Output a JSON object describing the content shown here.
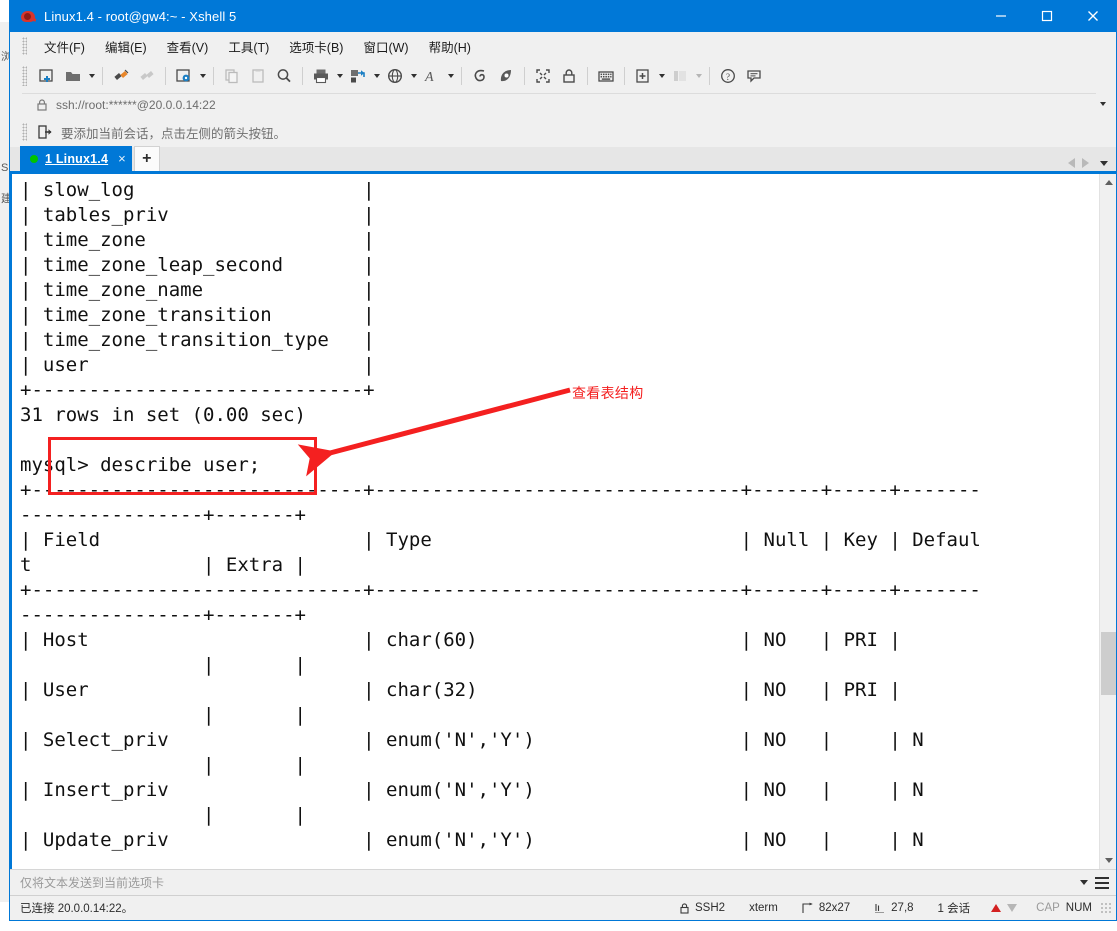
{
  "window": {
    "title": "Linux1.4 - root@gw4:~ - Xshell 5",
    "app_icon": "xshell-icon",
    "controls": {
      "minimize": "minimize-icon",
      "maximize": "maximize-icon",
      "close": "close-icon"
    }
  },
  "menubar": {
    "items": [
      {
        "label": "文件(F)",
        "name": "menu-file"
      },
      {
        "label": "编辑(E)",
        "name": "menu-edit"
      },
      {
        "label": "查看(V)",
        "name": "menu-view"
      },
      {
        "label": "工具(T)",
        "name": "menu-tools"
      },
      {
        "label": "选项卡(B)",
        "name": "menu-tabs"
      },
      {
        "label": "窗口(W)",
        "name": "menu-window"
      },
      {
        "label": "帮助(H)",
        "name": "menu-help"
      }
    ]
  },
  "toolbar": {
    "icons": [
      "new-session-icon",
      "open-folder-icon",
      "connect-icon",
      "disconnect-icon",
      "session-properties-icon",
      "copy-icon",
      "paste-icon",
      "find-icon",
      "print-icon",
      "transfer-icon",
      "globe-icon",
      "font-icon",
      "ssh-tunnel-icon",
      "sftp-icon",
      "fullscreen-icon",
      "lock-icon",
      "keyboard-icon",
      "add-note-icon",
      "layout-icon",
      "help-icon",
      "comment-icon"
    ]
  },
  "addressbar": {
    "lock_icon": "lock-icon",
    "value": "ssh://root:******@20.0.0.14:22",
    "dropdown_icon": "chevron-down-icon"
  },
  "notice": {
    "icon": "add-session-icon",
    "text": "要添加当前会话，点击左侧的箭头按钮。"
  },
  "tabs": {
    "items": [
      {
        "index": "1",
        "label": "1 Linux1.4",
        "close": "×",
        "status_dot": "connected"
      }
    ],
    "new_tab_label": "+",
    "nav_prev": "prev-tab-icon",
    "nav_next": "next-tab-icon",
    "nav_list": "tab-list-icon"
  },
  "terminal": {
    "content": "| slow_log                    |\n| tables_priv                 |\n| time_zone                   |\n| time_zone_leap_second       |\n| time_zone_name              |\n| time_zone_transition        |\n| time_zone_transition_type   |\n| user                        |\n+-----------------------------+\n31 rows in set (0.00 sec)\n\nmysql> describe user;\n+-----------------------------+--------------------------------+------+-----+-------\n----------------+-------+\n| Field                       | Type                           | Null | Key | Defaul\nt               | Extra |\n+-----------------------------+--------------------------------+------+-----+-------\n----------------+-------+\n| Host                        | char(60)                       | NO   | PRI |\n                |       |\n| User                        | char(32)                       | NO   | PRI |\n                |       |\n| Select_priv                 | enum('N','Y')                  | NO   |     | N\n                |       |\n| Insert_priv                 | enum('N','Y')                  | NO   |     | N\n                |       |\n| Update_priv                 | enum('N','Y')                  | NO   |     | N",
    "lines": [
      "| slow_log                    |",
      "| tables_priv                 |",
      "| time_zone                   |",
      "| time_zone_leap_second       |",
      "| time_zone_name              |",
      "| time_zone_transition        |",
      "| time_zone_transition_type   |",
      "| user                        |",
      "+-----------------------------+",
      "31 rows in set (0.00 sec)",
      "",
      "mysql> describe user;",
      "+-----------------------------+--------------------------------+------+-----+-------",
      "----------------+-------+",
      "| Field                       | Type                           | Null | Key | Defaul",
      "t               | Extra |",
      "+-----------------------------+--------------------------------+------+-----+-------",
      "----------------+-------+",
      "| Host                        | char(60)                       | NO   | PRI |",
      "                |       |",
      "| User                        | char(32)                       | NO   | PRI |",
      "                |       |",
      "| Select_priv                 | enum('N','Y')                  | NO   |     | N",
      "                |       |",
      "| Insert_priv                 | enum('N','Y')                  | NO   |     | N",
      "                |       |",
      "| Update_priv                 | enum('N','Y')                  | NO   |     | N"
    ],
    "prompt_command": "mysql> describe user;",
    "row_count_message": "31 rows in set (0.00 sec)",
    "table": {
      "headers": [
        "Field",
        "Type",
        "Null",
        "Key",
        "Default",
        "Extra"
      ],
      "rows": [
        [
          "Host",
          "char(60)",
          "NO",
          "PRI",
          "",
          ""
        ],
        [
          "User",
          "char(32)",
          "NO",
          "PRI",
          "",
          ""
        ],
        [
          "Select_priv",
          "enum('N','Y')",
          "NO",
          "",
          "N",
          ""
        ],
        [
          "Insert_priv",
          "enum('N','Y')",
          "NO",
          "",
          "N",
          ""
        ],
        [
          "Update_priv",
          "enum('N','Y')",
          "NO",
          "",
          "N",
          ""
        ]
      ]
    }
  },
  "annotation": {
    "label": "查看表结构",
    "color": "#f42020",
    "box_target": "mysql> describe user;"
  },
  "sendbar": {
    "placeholder": "仅将文本发送到当前选项卡",
    "value": "",
    "dropdown_icon": "chevron-down-icon",
    "menu_icon": "hamburger-icon"
  },
  "statusbar": {
    "connection": "已连接 20.0.0.14:22。",
    "protocol_icon": "lock-icon",
    "protocol": "SSH2",
    "term_type": "xterm",
    "size_icon": "resize-icon",
    "size": "82x27",
    "cursor_icon": "cursor-icon",
    "cursor": "27,8",
    "sessions": "1 会话",
    "upload_icon": "arrow-up-icon",
    "download_icon": "arrow-down-icon",
    "caps": "CAP",
    "num": "NUM"
  },
  "background_window": {
    "fragments": [
      "浏",
      "建",
      "S"
    ]
  },
  "colors": {
    "titlebar": "#0078d7",
    "accent": "#0078d7",
    "annotation_red": "#f42020",
    "terminal_bg": "#ffffff",
    "terminal_fg": "#101010",
    "chrome_bg": "#f0f0f0",
    "tab_active": "#0078d7",
    "status_dot_green": "#00c400"
  }
}
